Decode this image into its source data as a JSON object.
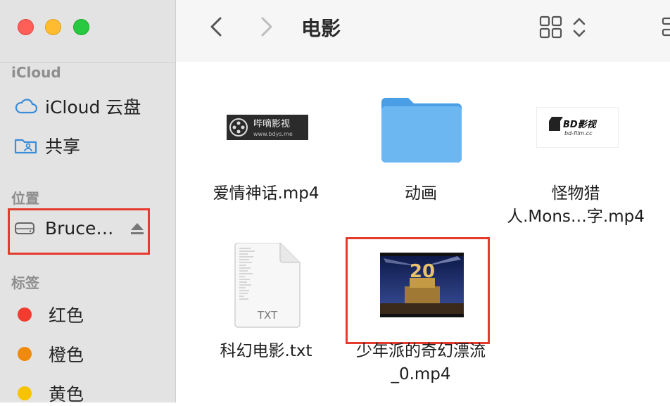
{
  "window": {
    "title": "电影",
    "controls": [
      "close",
      "minimize",
      "zoom"
    ]
  },
  "sidebar": {
    "sections": [
      {
        "heading": "iCloud",
        "items": [
          {
            "label": "iCloud 云盘",
            "icon": "cloud-icon"
          },
          {
            "label": "共享",
            "icon": "shared-folder-icon"
          }
        ]
      },
      {
        "heading": "位置",
        "items": [
          {
            "label": "Bruce…",
            "icon": "drive-icon",
            "eject": true
          }
        ]
      },
      {
        "heading": "标签",
        "items": [
          {
            "label": "红色",
            "color": "#f23c2f"
          },
          {
            "label": "橙色",
            "color": "#f08a0c"
          },
          {
            "label": "黄色",
            "color": "#f7c300"
          }
        ]
      }
    ]
  },
  "toolbar": {
    "back_icon": "chevron-left-icon",
    "forward_icon": "chevron-right-icon",
    "view_icon": "grid-view-icon",
    "sort_icon": "up-down-chevron-icon"
  },
  "files": [
    {
      "name": "爱情神话.mp4",
      "kind": "video",
      "thumb_text": "哔嘀影视",
      "thumb_sub": "www.bdys.me"
    },
    {
      "name": "动画",
      "kind": "folder"
    },
    {
      "name_lines": [
        "怪物猎",
        "人.Mons…字.mp4"
      ],
      "kind": "video",
      "thumb_text": "BD影视",
      "thumb_sub": "bd-film.cc"
    },
    {
      "name": "科幻电影.txt",
      "kind": "text",
      "ext": "TXT"
    },
    {
      "name_lines": [
        "少年派的奇幻漂流",
        "_0.mp4"
      ],
      "kind": "video",
      "thumb_text": "20"
    }
  ],
  "highlight_color": "#e53b2f"
}
